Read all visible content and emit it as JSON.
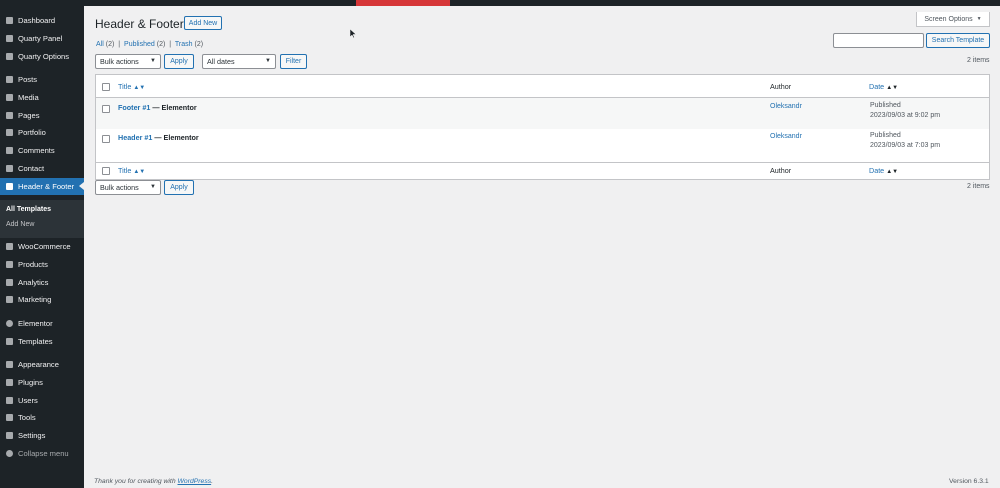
{
  "sidebar": {
    "items": [
      {
        "label": "Dashboard",
        "icon": "dashboard-icon"
      },
      {
        "label": "Quarty Panel",
        "icon": "grid-icon"
      },
      {
        "label": "Quarty Options",
        "icon": "grid-icon"
      },
      {
        "label": "Posts",
        "icon": "pin-icon"
      },
      {
        "label": "Media",
        "icon": "media-icon"
      },
      {
        "label": "Pages",
        "icon": "pages-icon"
      },
      {
        "label": "Portfolio",
        "icon": "portfolio-icon"
      },
      {
        "label": "Comments",
        "icon": "comments-icon"
      },
      {
        "label": "Contact",
        "icon": "mail-icon"
      },
      {
        "label": "Header & Footer",
        "icon": "list-icon"
      },
      {
        "label": "WooCommerce",
        "icon": "woocommerce-icon"
      },
      {
        "label": "Products",
        "icon": "products-icon"
      },
      {
        "label": "Analytics",
        "icon": "analytics-icon"
      },
      {
        "label": "Marketing",
        "icon": "megaphone-icon"
      },
      {
        "label": "Elementor",
        "icon": "elementor-icon"
      },
      {
        "label": "Templates",
        "icon": "templates-icon"
      },
      {
        "label": "Appearance",
        "icon": "paintbrush-icon"
      },
      {
        "label": "Plugins",
        "icon": "plugins-icon"
      },
      {
        "label": "Users",
        "icon": "users-icon"
      },
      {
        "label": "Tools",
        "icon": "wrench-icon"
      },
      {
        "label": "Settings",
        "icon": "settings-icon"
      },
      {
        "label": "Collapse menu",
        "icon": "collapse-icon"
      }
    ],
    "submenu": {
      "all_templates": "All Templates",
      "add_new": "Add New"
    }
  },
  "header": {
    "title": "Header & Footer",
    "add_new": "Add New",
    "screen_options": "Screen Options",
    "screen_options_caret": "▼"
  },
  "filters": {
    "all": "All",
    "all_count": "(2)",
    "published": "Published",
    "published_count": "(2)",
    "trash": "Trash",
    "trash_count": "(2)",
    "sep": "|"
  },
  "search": {
    "button": "Search Template",
    "value": ""
  },
  "toolbar": {
    "bulk_actions": "Bulk actions",
    "apply": "Apply",
    "all_dates": "All dates",
    "filter": "Filter",
    "items": "2 items"
  },
  "table": {
    "columns": {
      "title": "Title",
      "author": "Author",
      "date": "Date"
    },
    "sort_both": "▲▼",
    "sort_down": "▲▼",
    "rows": [
      {
        "title_link": "Footer #1",
        "title_suffix": " — Elementor",
        "author": "Oleksandr",
        "status": "Published",
        "date": "2023/09/03 at 9:02 pm"
      },
      {
        "title_link": "Header #1",
        "title_suffix": " — Elementor",
        "author": "Oleksandr",
        "status": "Published",
        "date": "2023/09/03 at 7:03 pm"
      }
    ]
  },
  "footer": {
    "thanks_prefix": "Thank you for creating with ",
    "wordpress": "WordPress",
    "thanks_suffix": ".",
    "version": "Version 6.3.1"
  },
  "colors": {
    "accent": "#2271b1",
    "sidebar": "#1d2327",
    "alert": "#d63638"
  }
}
